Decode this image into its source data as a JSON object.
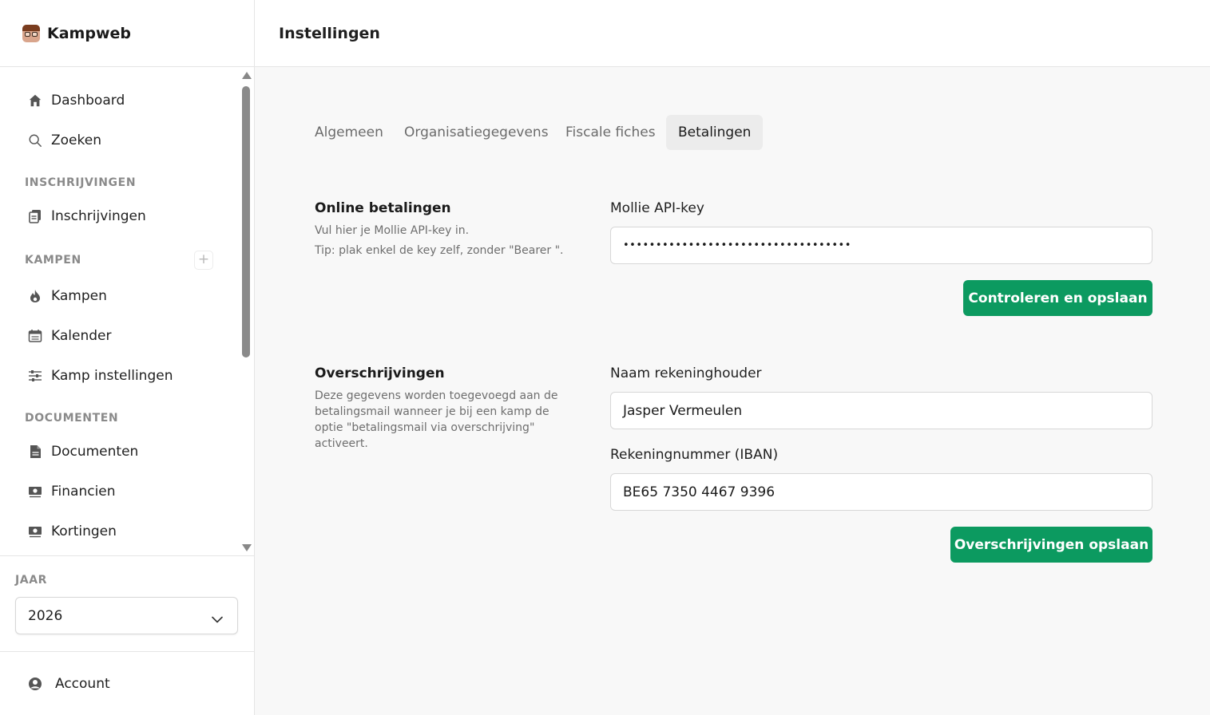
{
  "app": {
    "name": "Kampweb"
  },
  "nav": {
    "dashboard": "Dashboard",
    "search": "Zoeken",
    "section_registrations": "INSCHRIJVINGEN",
    "registrations": "Inschrijvingen",
    "section_camps": "KAMPEN",
    "camps": "Kampen",
    "calendar": "Kalender",
    "camp_settings": "Kamp instellingen",
    "section_documents": "DOCUMENTEN",
    "documents": "Documenten",
    "finances": "Financien",
    "discounts": "Kortingen",
    "add_symbol": "+"
  },
  "year": {
    "label": "JAAR",
    "value": "2026"
  },
  "account": {
    "label": "Account"
  },
  "header": {
    "title": "Instellingen"
  },
  "tabs": [
    {
      "label": "Algemeen",
      "active": false
    },
    {
      "label": "Organisatiegegevens",
      "active": false
    },
    {
      "label": "Fiscale fiches",
      "active": false
    },
    {
      "label": "Betalingen",
      "active": true
    }
  ],
  "online": {
    "title": "Online betalingen",
    "desc_line1": "Vul hier je Mollie API-key in.",
    "desc_line2": "Tip: plak enkel de key zelf, zonder \"Bearer \".",
    "field_label": "Mollie API-key",
    "field_value": "•••••••••••••••••••••••••••••••••••",
    "button": "Controleren en opslaan"
  },
  "transfer": {
    "title": "Overschrijvingen",
    "desc": "Deze gegevens worden toegevoegd aan de betalingsmail wanneer je bij een kamp de optie \"betalingsmail via overschrijving\" activeert.",
    "holder_label": "Naam rekeninghouder",
    "holder_value": "Jasper Vermeulen",
    "iban_label": "Rekeningnummer (IBAN)",
    "iban_value": "BE65 7350 4467 9396",
    "button": "Overschrijvingen opslaan"
  },
  "colors": {
    "accent": "#0c9a60",
    "active_tab_bg": "#ececec"
  },
  "icons": [
    "home-icon",
    "search-icon",
    "clipboard-icon",
    "fire-icon",
    "calendar-icon",
    "sliders-icon",
    "document-icon",
    "money-icon",
    "ticket-icon",
    "user-icon",
    "chevron-down-icon",
    "plus-icon"
  ]
}
